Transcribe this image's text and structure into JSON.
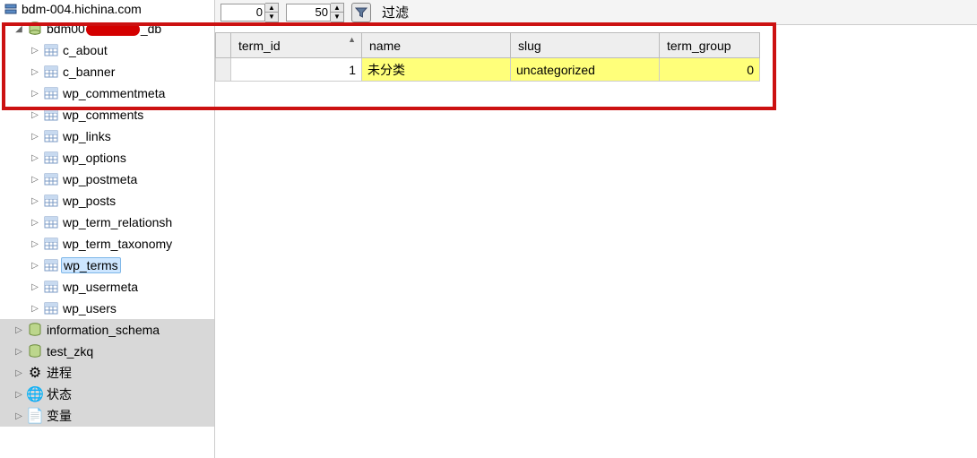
{
  "server": {
    "host": "bdm-004.hichina.com"
  },
  "database": {
    "prefix": "bdm00",
    "suffix": "_db"
  },
  "tables": [
    {
      "name": "c_about",
      "selected": false
    },
    {
      "name": "c_banner",
      "selected": false
    },
    {
      "name": "wp_commentmeta",
      "selected": false
    },
    {
      "name": "wp_comments",
      "selected": false
    },
    {
      "name": "wp_links",
      "selected": false
    },
    {
      "name": "wp_options",
      "selected": false
    },
    {
      "name": "wp_postmeta",
      "selected": false
    },
    {
      "name": "wp_posts",
      "selected": false
    },
    {
      "name": "wp_term_relationsh",
      "selected": false
    },
    {
      "name": "wp_term_taxonomy",
      "selected": false
    },
    {
      "name": "wp_terms",
      "selected": true
    },
    {
      "name": "wp_usermeta",
      "selected": false
    },
    {
      "name": "wp_users",
      "selected": false
    }
  ],
  "system_items": [
    {
      "name": "information_schema",
      "icon": "database"
    },
    {
      "name": "test_zkq",
      "icon": "database"
    },
    {
      "name": "进程",
      "icon": "process"
    },
    {
      "name": "状态",
      "icon": "globe"
    },
    {
      "name": "变量",
      "icon": "var"
    }
  ],
  "toolbar": {
    "offset": "0",
    "limit": "50",
    "filter_label": "过滤"
  },
  "grid": {
    "columns": [
      {
        "key": "term_id",
        "label": "term_id",
        "sorted": true
      },
      {
        "key": "name",
        "label": "name"
      },
      {
        "key": "slug",
        "label": "slug"
      },
      {
        "key": "term_group",
        "label": "term_group"
      }
    ],
    "rows": [
      {
        "term_id": "1",
        "name": "未分类",
        "slug": "uncategorized",
        "term_group": "0",
        "highlight": true
      }
    ]
  }
}
